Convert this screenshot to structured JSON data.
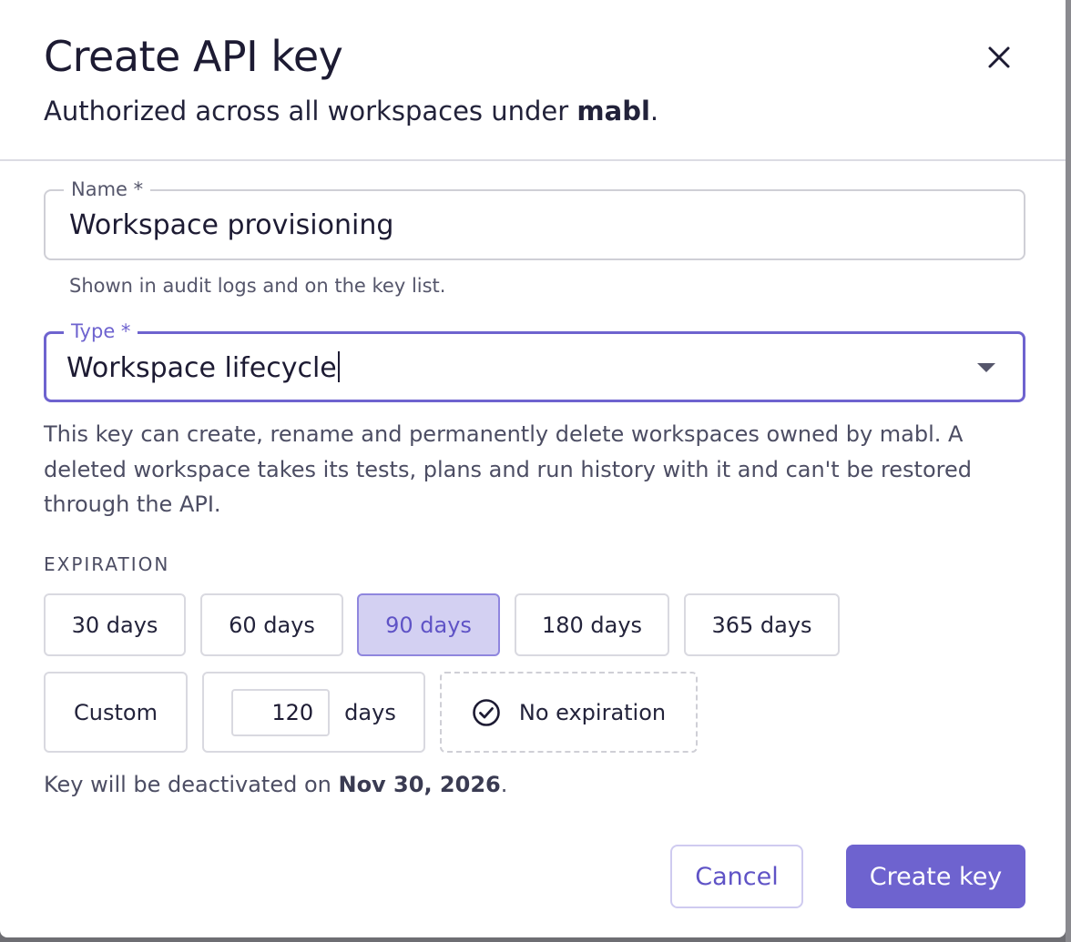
{
  "dialog": {
    "title": "Create API key",
    "subtitle_prefix": "Authorized across all workspaces under ",
    "subtitle_org": "mabl",
    "subtitle_suffix": "."
  },
  "name_field": {
    "label": "Name *",
    "value": "Workspace provisioning",
    "helper": "Shown in audit logs and on the key list."
  },
  "type_field": {
    "label": "Type *",
    "value": "Workspace lifecycle",
    "description": "This key can create, rename and permanently delete workspaces owned by mabl. A deleted workspace takes its tests, plans and run history with it and can't be restored through the API."
  },
  "expiration": {
    "section_label": "EXPIRATION",
    "options": [
      {
        "label": "30 days",
        "selected": false
      },
      {
        "label": "60 days",
        "selected": false
      },
      {
        "label": "90 days",
        "selected": true
      },
      {
        "label": "180 days",
        "selected": false
      },
      {
        "label": "365 days",
        "selected": false
      }
    ],
    "custom_label": "Custom",
    "custom_days_value": "120",
    "custom_days_unit": "days",
    "no_expiration_label": "No expiration",
    "deactivate_prefix": "Key will be deactivated on ",
    "deactivate_date": "Nov 30, 2026",
    "deactivate_suffix": "."
  },
  "footer": {
    "cancel_label": "Cancel",
    "create_label": "Create key"
  },
  "colors": {
    "accent": "#6e63cf",
    "selected_chip_bg": "#d3d0f2",
    "text_primary": "#1d1b33",
    "text_secondary": "#4c4d63"
  },
  "icons": {
    "close": "close-icon",
    "dropdown": "chevron-down-icon",
    "no_expiration": "check-circle-icon"
  }
}
